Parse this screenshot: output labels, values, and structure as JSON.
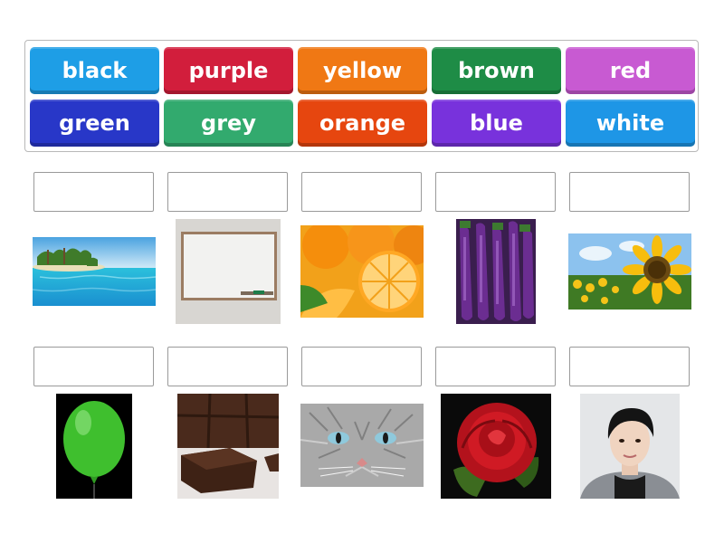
{
  "word_bank": {
    "tiles": [
      {
        "label": "black",
        "color": "#1e9ee6"
      },
      {
        "label": "purple",
        "color": "#d21e3c"
      },
      {
        "label": "yellow",
        "color": "#f07814"
      },
      {
        "label": "brown",
        "color": "#1e8c46"
      },
      {
        "label": "red",
        "color": "#c85ad2"
      },
      {
        "label": "green",
        "color": "#2837c8"
      },
      {
        "label": "grey",
        "color": "#32aa6e"
      },
      {
        "label": "orange",
        "color": "#e6460f"
      },
      {
        "label": "blue",
        "color": "#7832dc"
      },
      {
        "label": "white",
        "color": "#1e96e6"
      }
    ]
  },
  "row1": {
    "slots": [
      "",
      "",
      "",
      "",
      ""
    ],
    "pictures": [
      "tropical-sea-icon",
      "whiteboard-icon",
      "oranges-icon",
      "eggplants-icon",
      "sunflower-icon"
    ]
  },
  "row2": {
    "slots": [
      "",
      "",
      "",
      "",
      ""
    ],
    "pictures": [
      "green-balloon-icon",
      "brownies-icon",
      "grey-cat-icon",
      "red-rose-icon",
      "man-portrait-icon"
    ]
  }
}
